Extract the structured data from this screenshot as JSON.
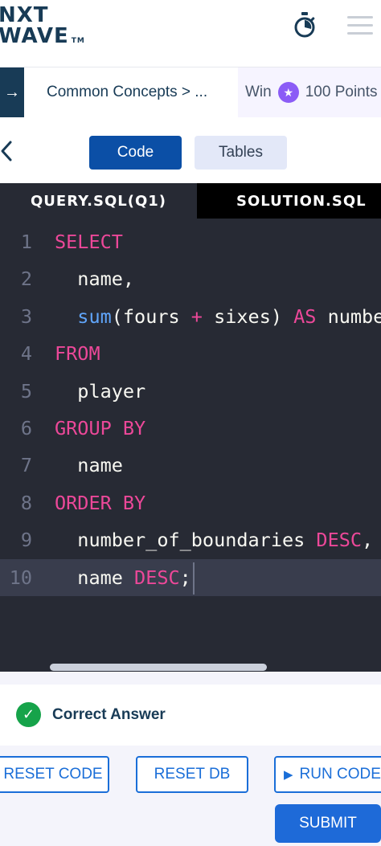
{
  "header": {
    "logo_line1": "NXT",
    "logo_line2": "WAVE",
    "logo_tm": "TM",
    "icons": [
      "stopwatch-icon",
      "hamburger-menu-icon"
    ]
  },
  "breadcrumb": {
    "text": "Common Concepts > ...",
    "reward_win": "Win",
    "reward_points": "100 Points",
    "icons": [
      "sidebar-toggle-arrow-icon",
      "star-coin-icon"
    ]
  },
  "view_tabs": {
    "back_icon": "chevron-left-icon",
    "code": "Code",
    "tables": "Tables"
  },
  "file_tabs": {
    "query": "QUERY.SQL(Q1)",
    "solution": "SOLUTION.SQL"
  },
  "editor": {
    "lines": [
      {
        "num": "1",
        "tokens": [
          [
            "kw",
            "SELECT"
          ]
        ]
      },
      {
        "num": "2",
        "tokens": [
          [
            "txt",
            "  name,"
          ]
        ]
      },
      {
        "num": "3",
        "tokens": [
          [
            "txt",
            "  "
          ],
          [
            "fn",
            "sum"
          ],
          [
            "txt",
            "(fours "
          ],
          [
            "op",
            "+"
          ],
          [
            "txt",
            " sixes) "
          ],
          [
            "kw",
            "AS"
          ],
          [
            "txt",
            " number_of_boundaries,"
          ]
        ]
      },
      {
        "num": "4",
        "tokens": [
          [
            "kw",
            "FROM"
          ]
        ]
      },
      {
        "num": "5",
        "tokens": [
          [
            "txt",
            "  player"
          ]
        ]
      },
      {
        "num": "6",
        "tokens": [
          [
            "kw",
            "GROUP BY"
          ]
        ]
      },
      {
        "num": "7",
        "tokens": [
          [
            "txt",
            "  name"
          ]
        ]
      },
      {
        "num": "8",
        "tokens": [
          [
            "kw",
            "ORDER BY"
          ]
        ]
      },
      {
        "num": "9",
        "tokens": [
          [
            "txt",
            "  number_of_boundaries "
          ],
          [
            "kw",
            "DESC"
          ],
          [
            "txt",
            ","
          ]
        ]
      },
      {
        "num": "10",
        "tokens": [
          [
            "txt",
            "  name "
          ],
          [
            "kw",
            "DESC"
          ],
          [
            "txt",
            ";"
          ]
        ],
        "active": true
      }
    ]
  },
  "result": {
    "status": "Correct Answer",
    "icon": "check-circle-icon"
  },
  "actions": {
    "reset_code": "RESET CODE",
    "reset_db": "RESET DB",
    "run_code": "RUN CODE",
    "submit": "SUBMIT",
    "run_icon": "play-icon"
  },
  "colors": {
    "brand_navy": "#183b56",
    "primary_blue": "#0b4fa6",
    "editor_bg": "#272a34",
    "keyword_pink": "#ec4899",
    "function_blue": "#60a5fa",
    "success_green": "#16a34a"
  }
}
